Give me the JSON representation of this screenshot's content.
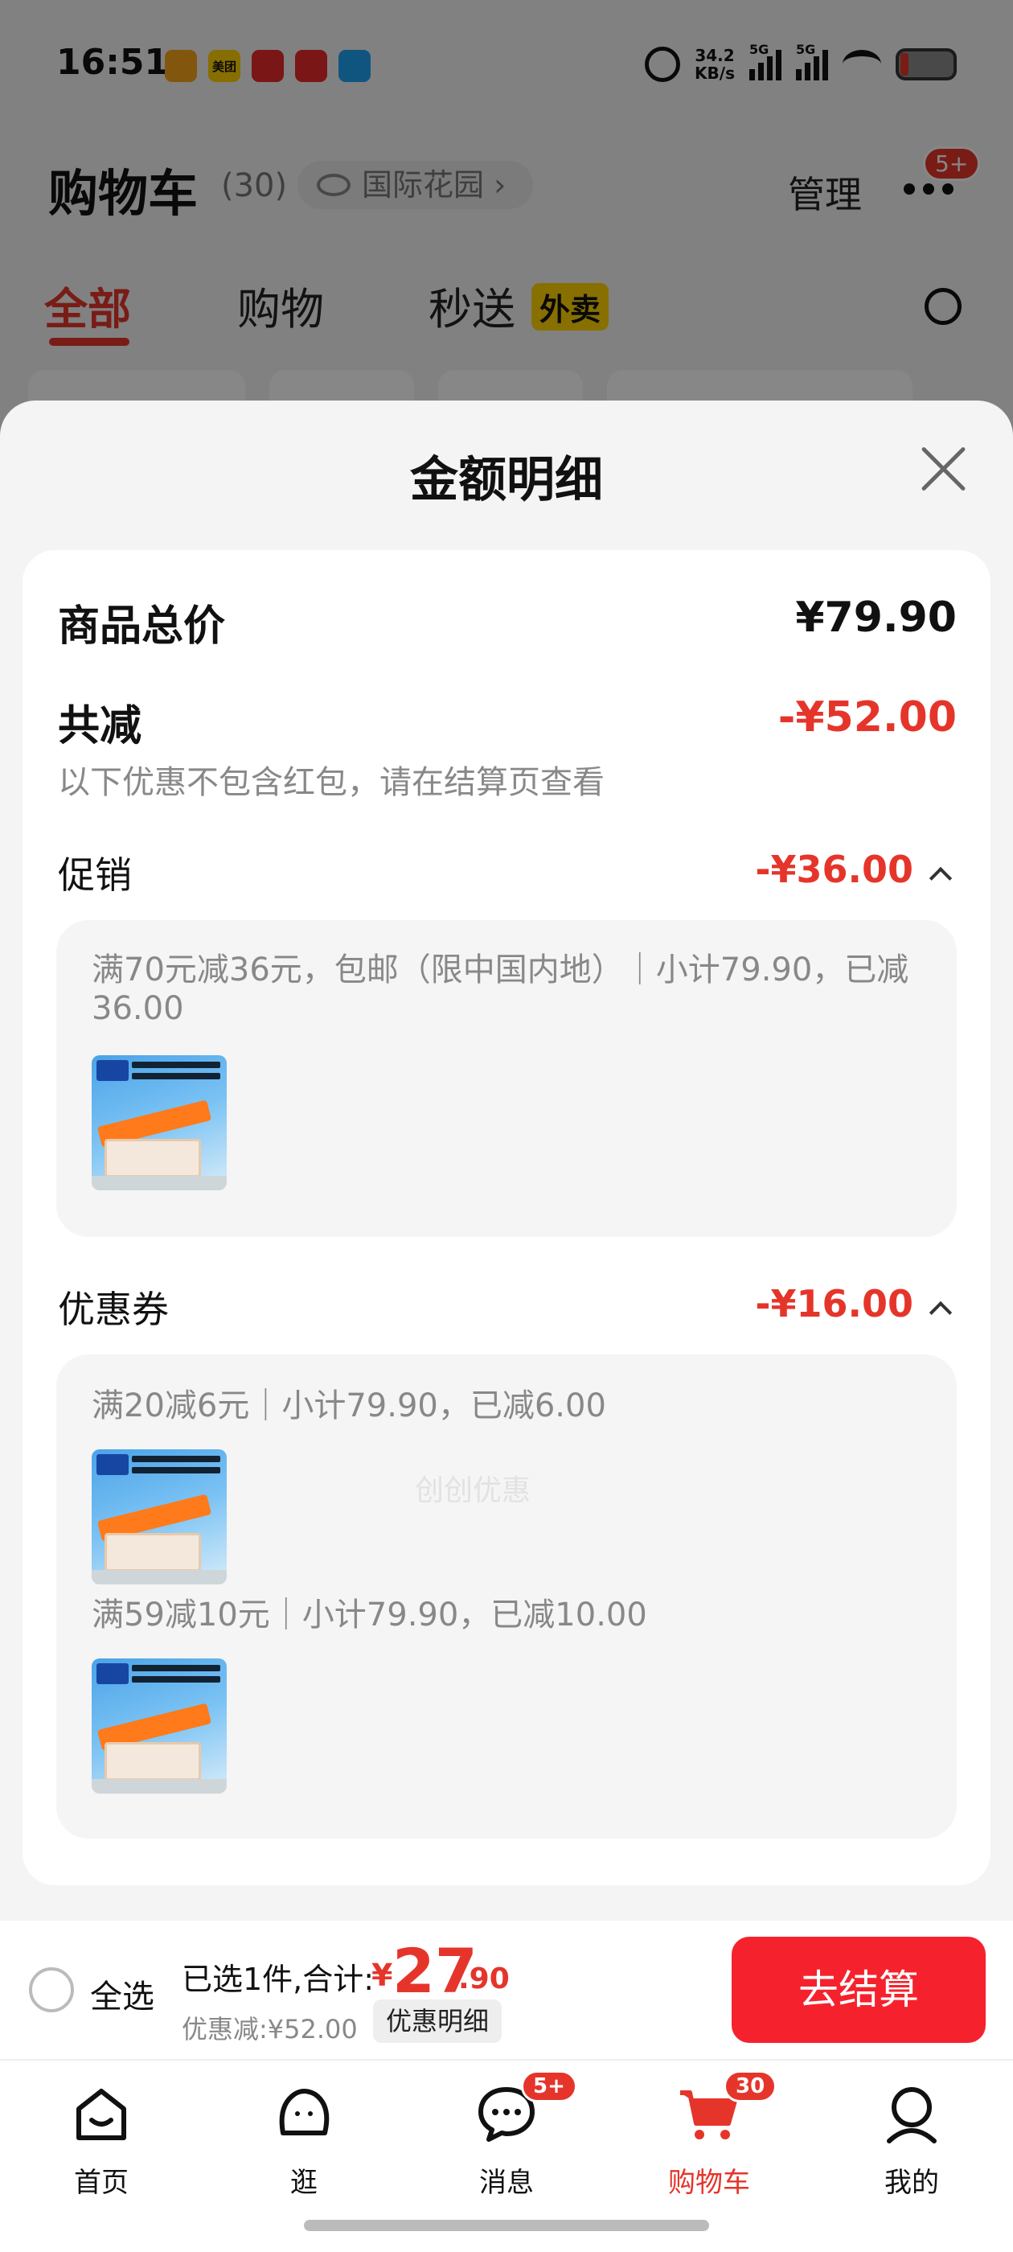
{
  "status_bar": {
    "time": "16:51",
    "notif_apps": [
      "美团"
    ],
    "net_speed_value": "34.2",
    "net_speed_unit": "KB/s",
    "signal1": "5G",
    "signal2": "5G"
  },
  "background": {
    "title": "购物车",
    "count": "(30)",
    "location": "国际花园",
    "manage": "管理",
    "more_badge": "5+",
    "tabs": [
      "全部",
      "购物",
      "秒送"
    ],
    "tab_tag": "外卖"
  },
  "sheet": {
    "title": "金额明细",
    "total_label": "商品总价",
    "total_value": "¥79.90",
    "discount_label": "共减",
    "discount_value": "-¥52.00",
    "discount_note": "以下优惠不包含红包，请在结算页查看",
    "promo": {
      "label": "促销",
      "value": "-¥36.00",
      "text": "满70元减36元，包邮（限中国内地）｜小计79.90，已减36.00"
    },
    "coupon": {
      "label": "优惠券",
      "value": "-¥16.00",
      "items": [
        "满20减6元｜小计79.90，已减6.00",
        "满59减10元｜小计79.90，已减10.00"
      ]
    },
    "watermark": "创创优惠"
  },
  "checkout": {
    "select_all": "全选",
    "selected": "已选1件,合计:",
    "currency": "¥",
    "total_integer": "27",
    "total_decimal": ".90",
    "discount": "优惠减:¥52.00",
    "details_button": "优惠明细",
    "checkout_button": "去结算"
  },
  "tab_bar": {
    "items": [
      {
        "label": "首页",
        "icon": "home-icon"
      },
      {
        "label": "逛",
        "icon": "browse-icon"
      },
      {
        "label": "消息",
        "icon": "message-icon",
        "badge": "5+"
      },
      {
        "label": "购物车",
        "icon": "cart-icon",
        "badge": "30"
      },
      {
        "label": "我的",
        "icon": "profile-icon"
      }
    ]
  },
  "colors": {
    "accent": "#e5352b",
    "checkout_button": "#f5222d"
  }
}
